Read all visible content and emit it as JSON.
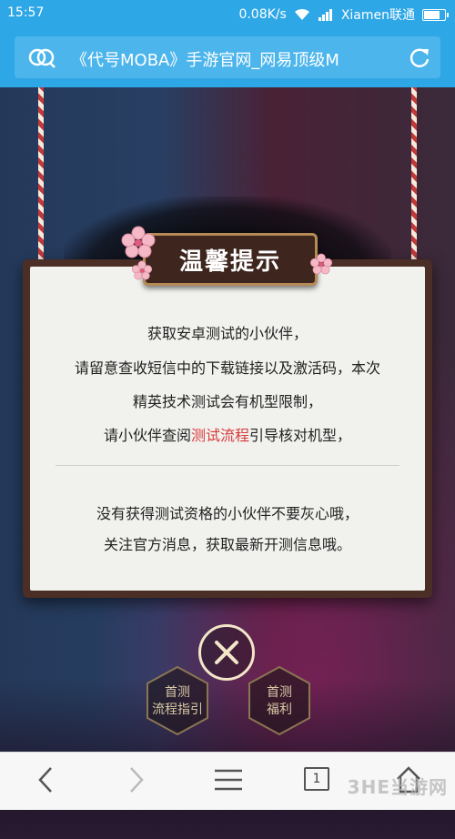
{
  "status_bar": {
    "time": "15:57",
    "speed": "0.08K/s",
    "carrier": "Xiamen联通"
  },
  "address_bar": {
    "title": "《代号MOBA》手游官网_网易顶级M"
  },
  "dialog": {
    "title": "温馨提示",
    "lines": [
      "获取安卓测试的小伙伴，",
      "请留意查收短信中的下载链接以及激活码，本次",
      "精英技术测试会有机型限制，"
    ],
    "line4_prefix": "请小伙伴查阅",
    "line4_link": "测试流程",
    "line4_suffix": "引导核对机型，",
    "lines2": [
      "没有获得测试资格的小伙伴不要灰心哦，",
      "关注官方消息，获取最新开测信息哦。"
    ]
  },
  "buttons": {
    "guide_line1": "首测",
    "guide_line2": "流程指引",
    "welfare_line1": "首测",
    "welfare_line2": "福利"
  },
  "bottom_nav": {
    "tab_count": "1",
    "watermark": "3HE当游网"
  },
  "colors": {
    "accent": "#2ea7e6",
    "link": "#d83a3a"
  }
}
